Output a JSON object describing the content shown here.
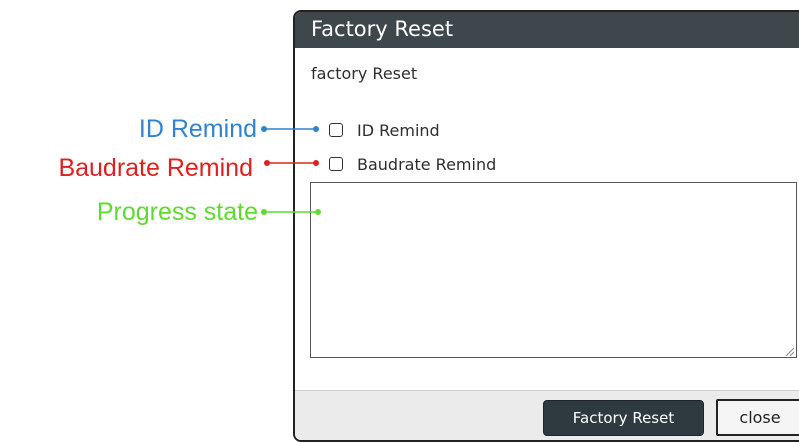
{
  "dialog": {
    "title": "Factory Reset",
    "subtitle": "factory Reset",
    "options": [
      {
        "label": "ID Remind",
        "checked": false
      },
      {
        "label": "Baudrate Remind",
        "checked": false
      }
    ],
    "progress_value": "",
    "buttons": {
      "factory_reset": "Factory Reset",
      "close": "close"
    }
  },
  "annotations": {
    "id_remind": {
      "text": "ID Remind",
      "color": "#2f83cf"
    },
    "baudrate_remind": {
      "text": "Baudrate Remind",
      "color": "#e02020"
    },
    "progress_state": {
      "text": "Progress state",
      "color": "#5fda2e"
    }
  },
  "colors": {
    "titlebar": "#3d474c",
    "footer": "#ebebeb",
    "primary_button": "#2f3a40"
  }
}
